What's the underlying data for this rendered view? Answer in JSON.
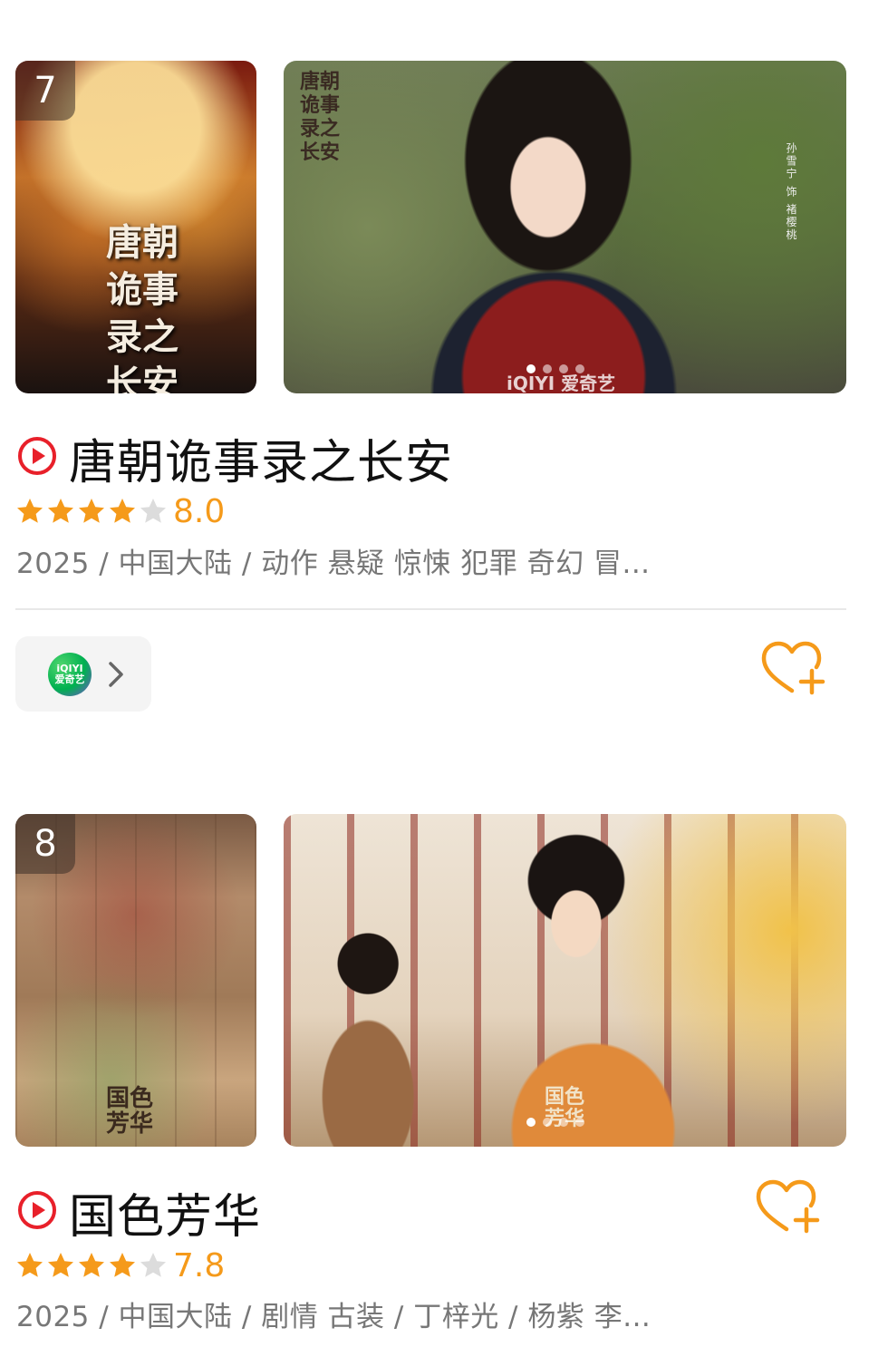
{
  "items": [
    {
      "rank": "7",
      "title": "唐朝诡事录之长安",
      "rating": 4,
      "score": "8.0",
      "meta": "2025 / 中国大陆 / 动作 悬疑 惊悚 犯罪 奇幻 冒...",
      "poster_text": "唐朝诡事录之长安",
      "still_text": "孙雪宁 饰 褚樱桃",
      "watermark": "iQIYI 爱奇艺",
      "carousel_dots": 4,
      "carousel_active": 0
    },
    {
      "rank": "8",
      "title": "国色芳华",
      "rating": 4,
      "score": "7.8",
      "meta": "2025 / 中国大陆 / 剧情 古装 / 丁梓光 / 杨紫 李...",
      "poster_text": "国色芳华",
      "carousel_dots": 4,
      "carousel_active": 0
    }
  ],
  "platform": {
    "name": "iQIYI 爱奇艺",
    "logo_top": "iQIYI",
    "logo_bottom": "爱奇艺"
  },
  "icons": {
    "play": "play-circle-icon",
    "star": "star-icon",
    "heart": "heart-plus-icon",
    "chevron": "chevron-right-icon"
  },
  "colors": {
    "play_red": "#e8202a",
    "star_orange": "#f59a1a",
    "star_gray": "#dcdcdc",
    "heart_orange": "#f59a1a"
  }
}
